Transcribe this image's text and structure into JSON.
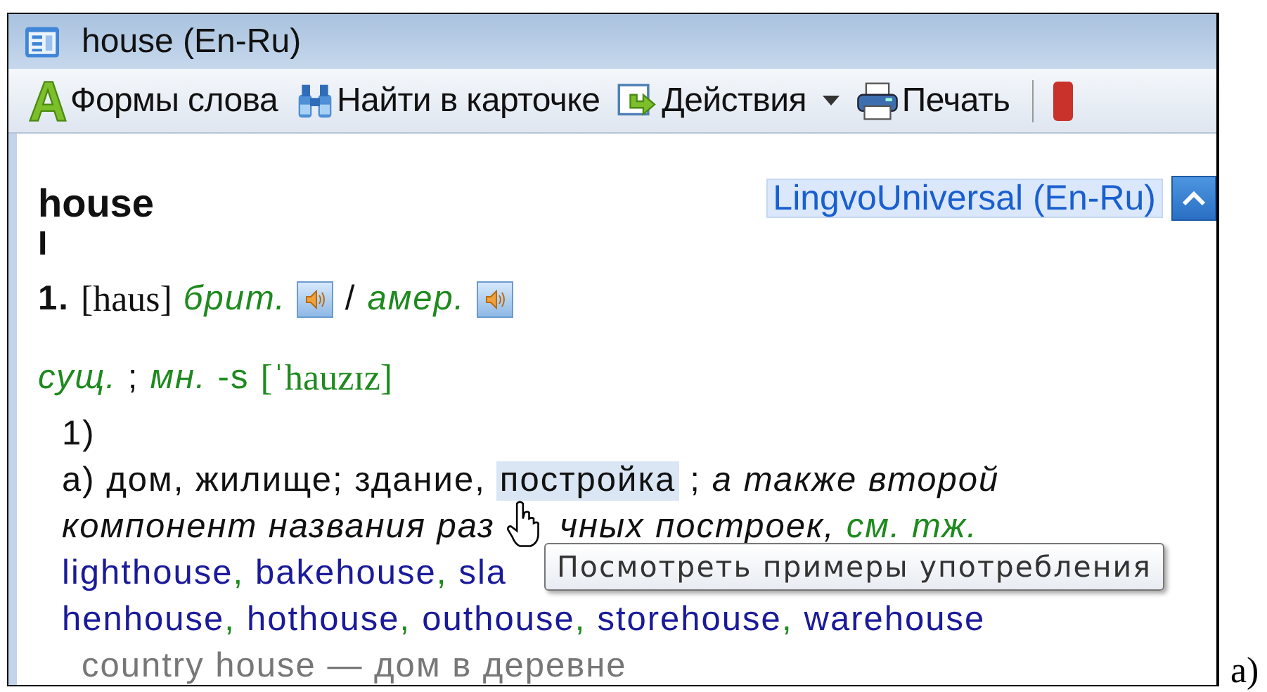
{
  "window": {
    "title": "house (En-Ru)"
  },
  "toolbar": [
    {
      "label": "Формы слова",
      "dropdown": false
    },
    {
      "label": "Найти в карточке",
      "dropdown": false
    },
    {
      "label": "Действия",
      "dropdown": true
    },
    {
      "label": "Печать",
      "dropdown": false
    }
  ],
  "card": {
    "headword": "house",
    "homonym": "I",
    "dictionary": "LingvoUniversal (En-Ru)",
    "header_lines": [
      [
        {
          "kind": "bold",
          "text": "1."
        },
        {
          "kind": "transcription",
          "text": "[haus]"
        },
        {
          "kind": "label",
          "text": "брит."
        },
        {
          "kind": "sound"
        },
        {
          "kind": "plain",
          "text": "/"
        },
        {
          "kind": "label",
          "text": "амер."
        },
        {
          "kind": "sound"
        }
      ],
      [
        {
          "kind": "label",
          "text": "сущ."
        },
        {
          "kind": "plain",
          "text": ";"
        },
        {
          "kind": "label",
          "text": "мн."
        },
        {
          "kind": "green",
          "text": "-s"
        },
        {
          "kind": "transcription-green",
          "text": "[ˈhauzɪz]"
        }
      ]
    ],
    "senses": [
      {
        "label": "1)",
        "children": [
          {
            "lines": [
              [
                {
                  "kind": "plain",
                  "text": "а) дом, жилище; здание,"
                },
                {
                  "kind": "highlight",
                  "text": "постройка"
                },
                {
                  "kind": "plain",
                  "text": ";"
                },
                {
                  "kind": "comment",
                  "text": "а также второй"
                }
              ],
              [
                {
                  "kind": "comment",
                  "text": "компонент названия раз"
                },
                {
                  "kind": "cursor"
                },
                {
                  "kind": "comment",
                  "text": "чных построек,"
                },
                {
                  "kind": "label",
                  "text": "см. тж."
                }
              ],
              [
                {
                  "kind": "link",
                  "text": "lighthouse",
                  "sep": ","
                },
                {
                  "kind": "link",
                  "text": "bakehouse",
                  "sep": ","
                },
                {
                  "kind": "link",
                  "text": "sla"
                }
              ],
              [
                {
                  "kind": "link",
                  "text": "henhouse",
                  "sep": ","
                },
                {
                  "kind": "link",
                  "text": "hothouse",
                  "sep": ","
                },
                {
                  "kind": "link",
                  "text": "outhouse",
                  "sep": ","
                },
                {
                  "kind": "link",
                  "text": "storehouse",
                  "sep": ","
                },
                {
                  "kind": "link",
                  "text": "warehouse"
                }
              ]
            ],
            "children": [
              {
                "lines": [
                  [
                    {
                      "kind": "example",
                      "text": "country house — дом в деревне"
                    }
                  ]
                ]
              }
            ]
          }
        ]
      }
    ]
  },
  "tooltip": "Посмотреть примеры употребления",
  "caption": "а)"
}
